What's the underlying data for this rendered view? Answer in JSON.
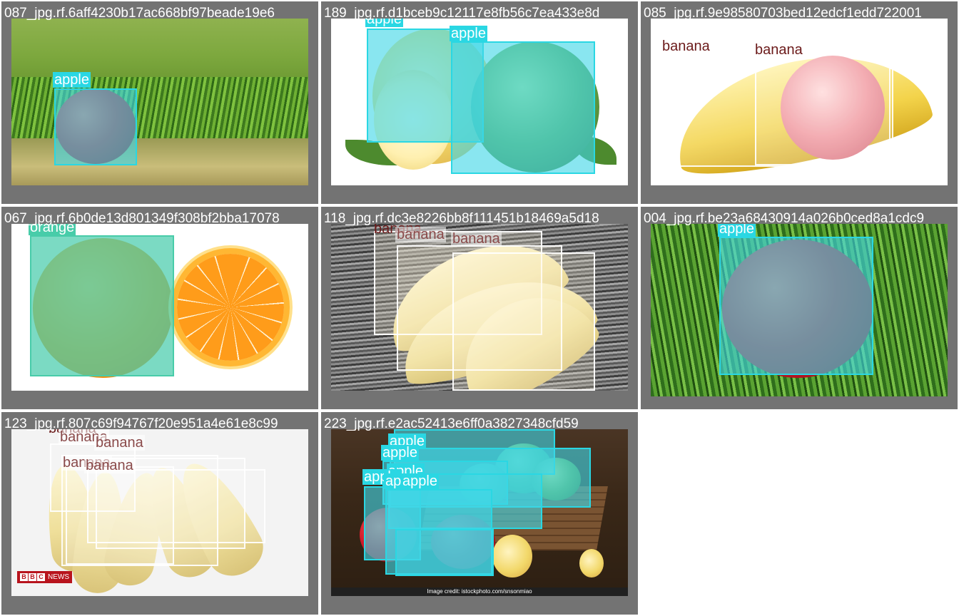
{
  "tiles": [
    {
      "title": "087_jpg.rf.6aff4230b17ac668bf97beade19e6",
      "labels": [
        "apple"
      ]
    },
    {
      "title": "189_jpg.rf.d1bceb9c12117e8fb56c7ea433e8d",
      "labels": [
        "apple",
        "apple"
      ]
    },
    {
      "title": "085_jpg.rf.9e98580703bed12edcf1edd722001",
      "labels": [
        "banana",
        "banana"
      ]
    },
    {
      "title": "067_jpg.rf.6b0de13d801349f308bf2bba17078",
      "labels": [
        "orange"
      ]
    },
    {
      "title": "118_jpg.rf.dc3e8226bb8f111451b18469a5d18",
      "labels": [
        "banana",
        "banana",
        "banana"
      ]
    },
    {
      "title": "004_jpg.rf.be23a68430914a026b0ced8a1cdc9",
      "labels": [
        "apple"
      ]
    },
    {
      "title": "123_jpg.rf.807c69f94767f20e951a4e61e8c99",
      "labels": [
        "banana",
        "banana",
        "banana",
        "banana",
        "banana"
      ]
    },
    {
      "title": "223_jpg.rf.e2ac52413e6ff0a3827348cfd59",
      "labels": [
        "apple",
        "apple",
        "apple",
        "apple",
        "apple",
        "apple",
        "apple"
      ]
    }
  ],
  "watermarks": {
    "bbc_letters": [
      "B",
      "B",
      "C"
    ],
    "bbc_news": "NEWS",
    "credit": "Image credit: istockphoto.com/snsonmiao"
  },
  "colors": {
    "apple_box": "#2ad7e3",
    "orange_box": "#48cca9",
    "banana_box": "#ffffff",
    "tile_bg": "#737373"
  }
}
